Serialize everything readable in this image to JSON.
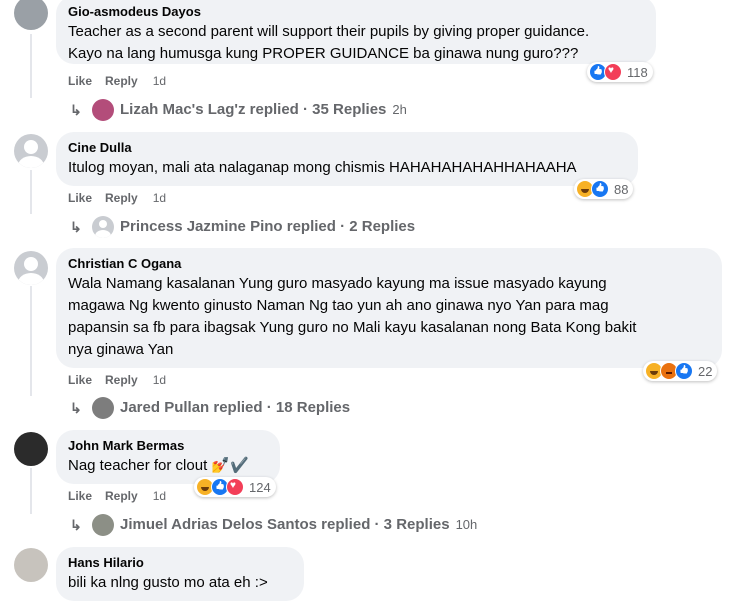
{
  "comments": [
    {
      "author": "Gio-asmodeus Dayos",
      "text_lines": [
        "Teacher as a second parent will support their pupils by giving proper guidance.",
        "Kayo na lang humusga kung PROPER GUIDANCE ba ginawa nung guro???"
      ],
      "like": "Like",
      "reply": "Reply",
      "time": "1d",
      "reaction_count": "118",
      "reactions": [
        "like-icon",
        "love-icon"
      ],
      "reply_summary": "Lizah Mac's Lag'z replied · 35 Replies",
      "reply_time": "2h"
    },
    {
      "author": "Cine Dulla",
      "text_lines": [
        "Itulog moyan, mali ata nalaganap mong chismis HAHAHAHAHAHHAHAAHA"
      ],
      "like": "Like",
      "reply": "Reply",
      "time": "1d",
      "reaction_count": "88",
      "reactions": [
        "haha-icon",
        "like-icon"
      ],
      "reply_summary": "Princess Jazmine Pino replied · 2 Replies",
      "reply_time": ""
    },
    {
      "author": "Christian C Ogana",
      "text_lines": [
        "Wala Namang kasalanan Yung guro masyado kayung ma issue masyado kayung",
        "magawa Ng kwento ginusto Naman Ng tao yun ah ano ginawa nyo Yan para mag",
        "papansin sa fb para ibagsak Yung guro no Mali kayu kasalanan nong Bata Kong bakit",
        "nya ginawa Yan"
      ],
      "like": "Like",
      "reply": "Reply",
      "time": "1d",
      "reaction_count": "22",
      "reactions": [
        "haha-icon",
        "angry-icon",
        "like-icon"
      ],
      "reply_summary": "Jared Pullan replied · 18 Replies",
      "reply_time": ""
    },
    {
      "author": "John Mark Bermas",
      "text_lines": [
        "Nag teacher for clout 💅✔️"
      ],
      "like": "Like",
      "reply": "Reply",
      "time": "1d",
      "reaction_count": "124",
      "reactions": [
        "haha-icon",
        "like-icon",
        "love-icon"
      ],
      "reply_summary": "Jimuel Adrias Delos Santos replied · 3 Replies",
      "reply_time": "10h"
    },
    {
      "author": "Hans Hilario",
      "text_lines": [
        "bili ka nlng gusto mo ata eh :>"
      ]
    }
  ]
}
